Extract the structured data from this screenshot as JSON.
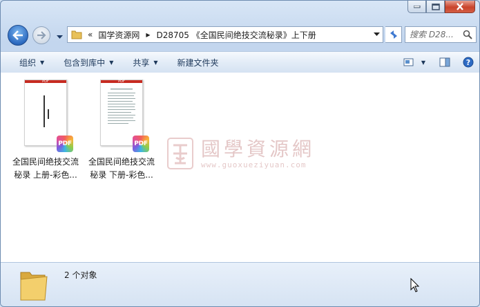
{
  "window": {
    "caption_buttons": [
      "minimize-icon",
      "maximize-icon",
      "close-icon"
    ]
  },
  "address": {
    "overflow": "«",
    "segments": [
      "国学资源网",
      "D28705 《全国民间绝技交流秘录》上下册"
    ]
  },
  "search": {
    "placeholder": "搜索 D28..."
  },
  "toolbar": {
    "organize": "组织",
    "include_library": "包含到库中",
    "share": "共享",
    "new_folder": "新建文件夹"
  },
  "files": [
    {
      "name_line1": "全国民间绝技交流",
      "name_line2": "秘录  上册-彩色...",
      "thumb_header": "PDF",
      "badge": "PDF"
    },
    {
      "name_line1": "全国民间绝技交流",
      "name_line2": "秘录  下册-彩色...",
      "thumb_header": "PDF",
      "badge": "PDF"
    }
  ],
  "watermark": {
    "text": "國學資源網",
    "url": "www.guoxueziyuan.com"
  },
  "details": {
    "count": "2 个对象"
  },
  "colors": {
    "accent": "#1e395b",
    "pdf_red": "#c72b21",
    "close_red": "#c9432b"
  }
}
